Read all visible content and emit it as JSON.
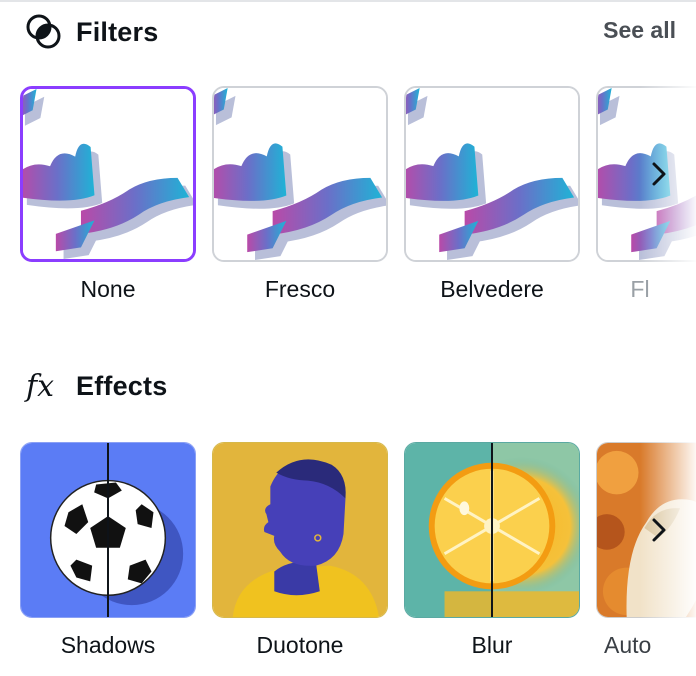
{
  "filters": {
    "title": "Filters",
    "icon": "filters-icon",
    "see_all": "See all",
    "tiles": [
      {
        "label": "None",
        "selected": true
      },
      {
        "label": "Fresco",
        "selected": false
      },
      {
        "label": "Belvedere",
        "selected": false
      },
      {
        "label": "Fl",
        "selected": false
      }
    ]
  },
  "effects": {
    "title": "Effects",
    "icon": "fx-icon",
    "tiles": [
      {
        "label": "Shadows",
        "image": "soccer-ball-shadow"
      },
      {
        "label": "Duotone",
        "image": "duotone-portrait"
      },
      {
        "label": "Blur",
        "image": "orange-blur"
      },
      {
        "label": "Auto",
        "image": "dog-autumn"
      }
    ]
  },
  "colors": {
    "accent": "#8b3dff",
    "text": "#0e1318",
    "muted": "#4a4f55",
    "border": "#cfd2d7"
  }
}
